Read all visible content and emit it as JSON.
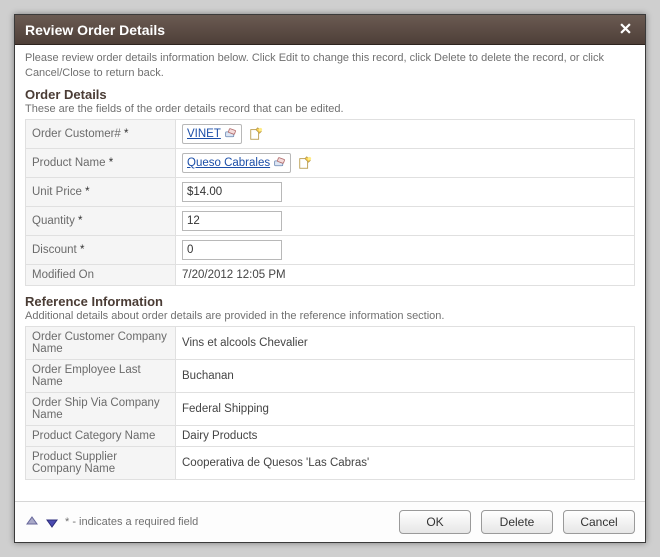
{
  "title": "Review Order Details",
  "instructions": "Please review order details information below. Click Edit to change this record, click Delete to delete the record, or click Cancel/Close to return back.",
  "section1": {
    "title": "Order Details",
    "desc": "These are the fields of the order details record that can be edited.",
    "fields": {
      "order_customer_label": "Order Customer#",
      "order_customer_value": "VINET",
      "product_name_label": "Product Name",
      "product_name_value": "Queso Cabrales",
      "unit_price_label": "Unit Price",
      "unit_price_value": "$14.00",
      "quantity_label": "Quantity",
      "quantity_value": "12",
      "discount_label": "Discount",
      "discount_value": "0",
      "modified_on_label": "Modified On",
      "modified_on_value": "7/20/2012 12:05 PM"
    }
  },
  "section2": {
    "title": "Reference Information",
    "desc": "Additional details about order details are provided in the reference information section.",
    "fields": {
      "cust_company_label": "Order Customer Company Name",
      "cust_company_value": "Vins et alcools Chevalier",
      "emp_last_label": "Order Employee Last Name",
      "emp_last_value": "Buchanan",
      "ship_via_label": "Order Ship Via Company Name",
      "ship_via_value": "Federal Shipping",
      "prod_cat_label": "Product Category Name",
      "prod_cat_value": "Dairy Products",
      "supplier_label": "Product Supplier Company Name",
      "supplier_value": "Cooperativa de Quesos 'Las Cabras'"
    }
  },
  "footer": {
    "note": "* - indicates a required field",
    "ok": "OK",
    "delete": "Delete",
    "cancel": "Cancel"
  },
  "star": "*"
}
